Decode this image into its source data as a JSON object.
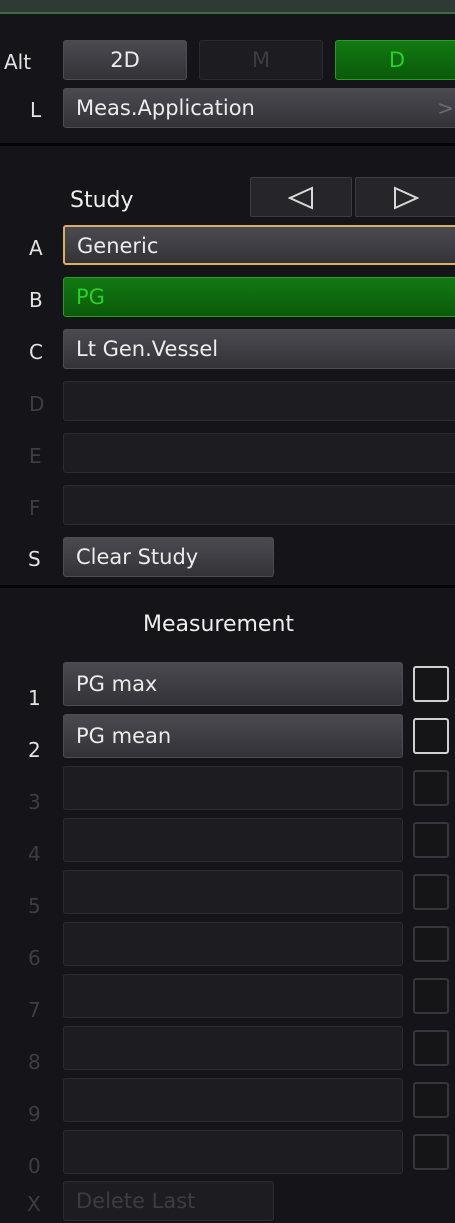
{
  "mode": {
    "alt_label": "Alt",
    "buttons": [
      {
        "label": "2D",
        "state": "normal"
      },
      {
        "label": "M",
        "state": "disabled"
      },
      {
        "label": "D",
        "state": "active"
      }
    ]
  },
  "app": {
    "key": "L",
    "label": "Meas.Application",
    "chevron": ">"
  },
  "study": {
    "heading": "Study",
    "prev_icon": "triangle-left-icon",
    "next_icon": "triangle-right-icon",
    "rows": [
      {
        "key": "A",
        "label": "Generic",
        "state": "selected"
      },
      {
        "key": "B",
        "label": "PG",
        "state": "active"
      },
      {
        "key": "C",
        "label": "Lt Gen.Vessel",
        "state": "normal"
      },
      {
        "key": "D",
        "label": "",
        "state": "empty"
      },
      {
        "key": "E",
        "label": "",
        "state": "empty"
      },
      {
        "key": "F",
        "label": "",
        "state": "empty"
      }
    ],
    "clear_key": "S",
    "clear_label": "Clear Study"
  },
  "measurement": {
    "heading": "Measurement",
    "rows": [
      {
        "key": "1",
        "label": "PG max",
        "enabled": true
      },
      {
        "key": "2",
        "label": "PG mean",
        "enabled": true
      },
      {
        "key": "3",
        "label": "",
        "enabled": false
      },
      {
        "key": "4",
        "label": "",
        "enabled": false
      },
      {
        "key": "5",
        "label": "",
        "enabled": false
      },
      {
        "key": "6",
        "label": "",
        "enabled": false
      },
      {
        "key": "7",
        "label": "",
        "enabled": false
      },
      {
        "key": "8",
        "label": "",
        "enabled": false
      },
      {
        "key": "9",
        "label": "",
        "enabled": false
      },
      {
        "key": "0",
        "label": "",
        "enabled": false
      }
    ],
    "delete_key": "X",
    "delete_label": "Delete Last"
  },
  "colors": {
    "background": "#141419",
    "active_green": "#28d028",
    "selected_border": "#d8b060"
  }
}
